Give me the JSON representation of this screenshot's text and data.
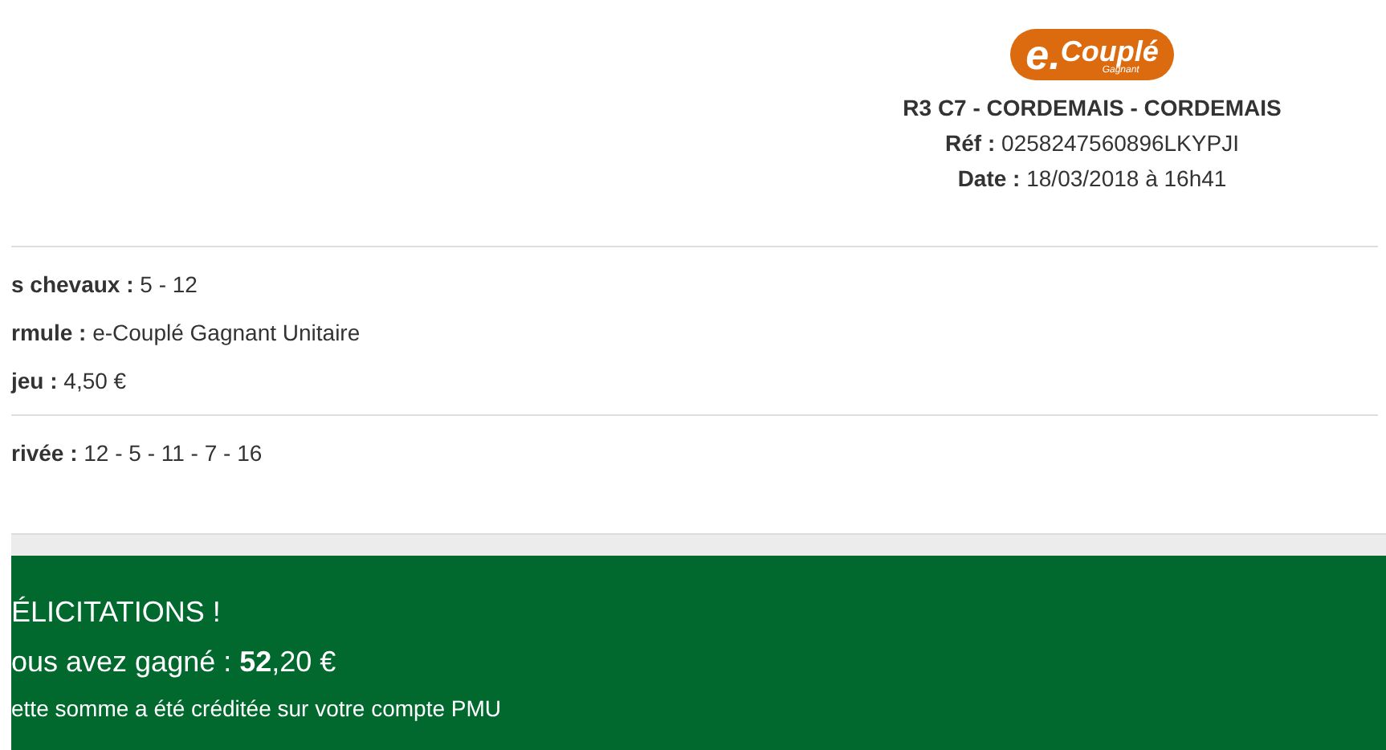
{
  "logo": {
    "prefix": "e.",
    "name": "Couplé",
    "sub": "Gagnant"
  },
  "header": {
    "race": "R3 C7 - CORDEMAIS - CORDEMAIS",
    "ref": "**Réf :** 0258247560896LKYPJI",
    "date": "**Date :** 18/03/2018 à 16h41"
  },
  "bet_details": [
    "**s chevaux :** 5 - 12",
    "**rmule :** e-Couplé Gagnant Unitaire",
    "**jeu :** 4,50 €"
  ],
  "result": "**rivée :** 12 - 5 - 11 - 7 - 16",
  "win_banner": {
    "title": "ÉLICITATIONS !",
    "amount": "ous avez gagné : **52**,20 €",
    "note": "ette somme a été créditée sur votre compte PMU"
  }
}
